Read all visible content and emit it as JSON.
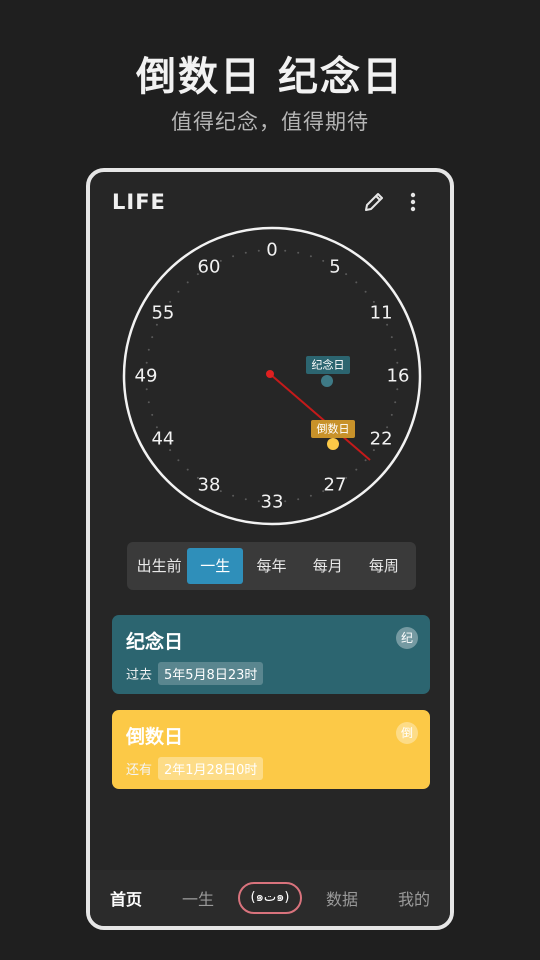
{
  "promo": {
    "headline": "倒数日 纪念日",
    "subheadline": "值得纪念，值得期待"
  },
  "app": {
    "title": "LIFE",
    "icons": {
      "edit": "pencil-icon",
      "more": "more-vertical-icon"
    }
  },
  "dial": {
    "labels": [
      "0",
      "5",
      "11",
      "16",
      "22",
      "27",
      "33",
      "38",
      "44",
      "49",
      "55",
      "60"
    ],
    "anniversary_tag": "纪念日",
    "countdown_tag": "倒数日",
    "colors": {
      "anniversary": "#2c6570",
      "countdown": "#fcc947",
      "hand": "#c41a1a"
    }
  },
  "tabs": [
    {
      "label": "出生前",
      "active": false
    },
    {
      "label": "一生",
      "active": true
    },
    {
      "label": "每年",
      "active": false
    },
    {
      "label": "每月",
      "active": false
    },
    {
      "label": "每周",
      "active": false
    }
  ],
  "cards": {
    "anniversary": {
      "title": "纪念日",
      "prefix": "过去",
      "value": "5年5月8日23时",
      "badge": "纪",
      "color": "#2c6570"
    },
    "countdown": {
      "title": "倒数日",
      "prefix": "还有",
      "value": "2年1月28日0时",
      "badge": "倒",
      "color": "#fcc947"
    }
  },
  "bottom_nav": {
    "home": "首页",
    "life": "一生",
    "center": "(๑ت๑)",
    "data": "数据",
    "mine": "我的"
  }
}
